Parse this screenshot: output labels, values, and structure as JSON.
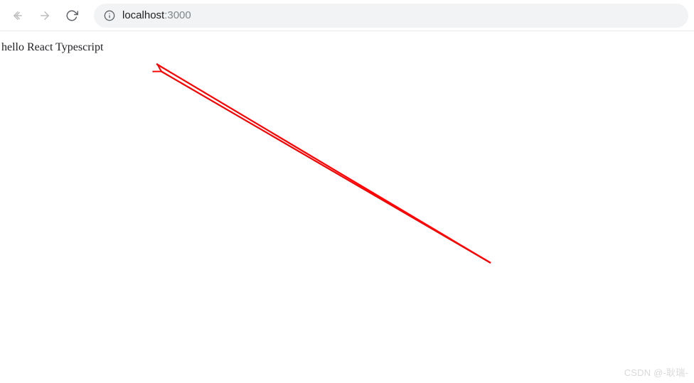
{
  "toolbar": {
    "url_host": "localhost",
    "url_port": ":3000"
  },
  "page": {
    "body_text": "hello React Typescript"
  },
  "watermark": {
    "text": "CSDN @-耿瑞-"
  },
  "annotation": {
    "color": "#ff0000"
  }
}
